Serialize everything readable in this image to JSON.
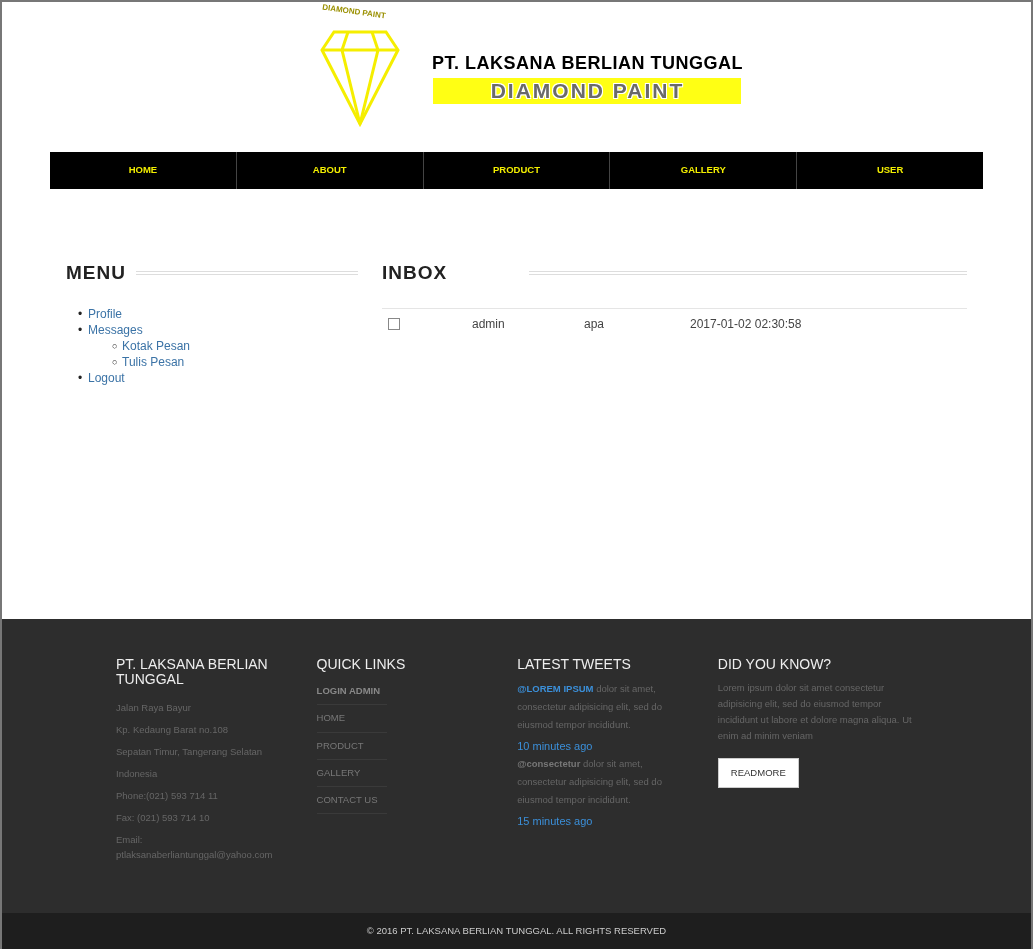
{
  "header": {
    "logo_arc_text": "DIAMOND PAINT",
    "company": "PT. LAKSANA BERLIAN TUNGGAL",
    "brand": "DIAMOND PAINT"
  },
  "nav": [
    {
      "label": "HOME"
    },
    {
      "label": "ABOUT"
    },
    {
      "label": "PRODUCT"
    },
    {
      "label": "GALLERY"
    },
    {
      "label": "USER"
    }
  ],
  "menu": {
    "title": "MENU",
    "items": [
      {
        "marker": "•",
        "label": "Profile"
      },
      {
        "marker": "•",
        "label": "Messages",
        "children": [
          {
            "marker": "○",
            "label": "Kotak Pesan"
          },
          {
            "marker": "○",
            "label": "Tulis Pesan"
          }
        ]
      },
      {
        "marker": "•",
        "label": "Logout"
      }
    ]
  },
  "inbox": {
    "title": "INBOX",
    "rows": [
      {
        "checked": false,
        "sender": "admin",
        "subject": "apa",
        "date": "2017-01-02 02:30:58"
      }
    ]
  },
  "footer": {
    "company": {
      "title": "PT. LAKSANA BERLIAN TUNGGAL",
      "lines": [
        "Jalan Raya Bayur",
        "Kp. Kedaung Barat no.108",
        "Sepatan Timur, Tangerang Selatan",
        "Indonesia",
        "Phone:(021) 593 714 11",
        "Fax: (021) 593 714 10",
        "Email: ptlaksanaberliantunggal@yahoo.com"
      ]
    },
    "quick_links": {
      "title": "QUICK LINKS",
      "links": [
        {
          "label": "LOGIN ADMIN",
          "bold": true
        },
        {
          "label": "HOME",
          "bold": false
        },
        {
          "label": "PRODUCT",
          "bold": false
        },
        {
          "label": "GALLERY",
          "bold": false
        },
        {
          "label": "CONTACT US",
          "bold": false
        }
      ]
    },
    "tweets": {
      "title": "LATEST TWEETS",
      "items": [
        {
          "handle": "@LOREM IPSUM",
          "highlighted": true,
          "text": "dolor sit amet, consectetur adipisicing elit, sed do eiusmod tempor incididunt.",
          "time": "10 minutes ago"
        },
        {
          "handle": "@consectetur",
          "highlighted": false,
          "text": "dolor sit amet, consectetur adipisicing elit, sed do eiusmod tempor incididunt.",
          "time": "15 minutes ago"
        }
      ]
    },
    "did_you_know": {
      "title": "DID YOU KNOW?",
      "text": "Lorem ipsum dolor sit amet consectetur adipisicing elit, sed do eiusmod tempor incididunt ut labore et dolore magna aliqua. Ut enim ad minim veniam",
      "button": "READMORE"
    }
  },
  "copyright": "© 2016 PT. LAKSANA BERLIAN TUNGGAL. ALL RIGHTS RESERVED"
}
